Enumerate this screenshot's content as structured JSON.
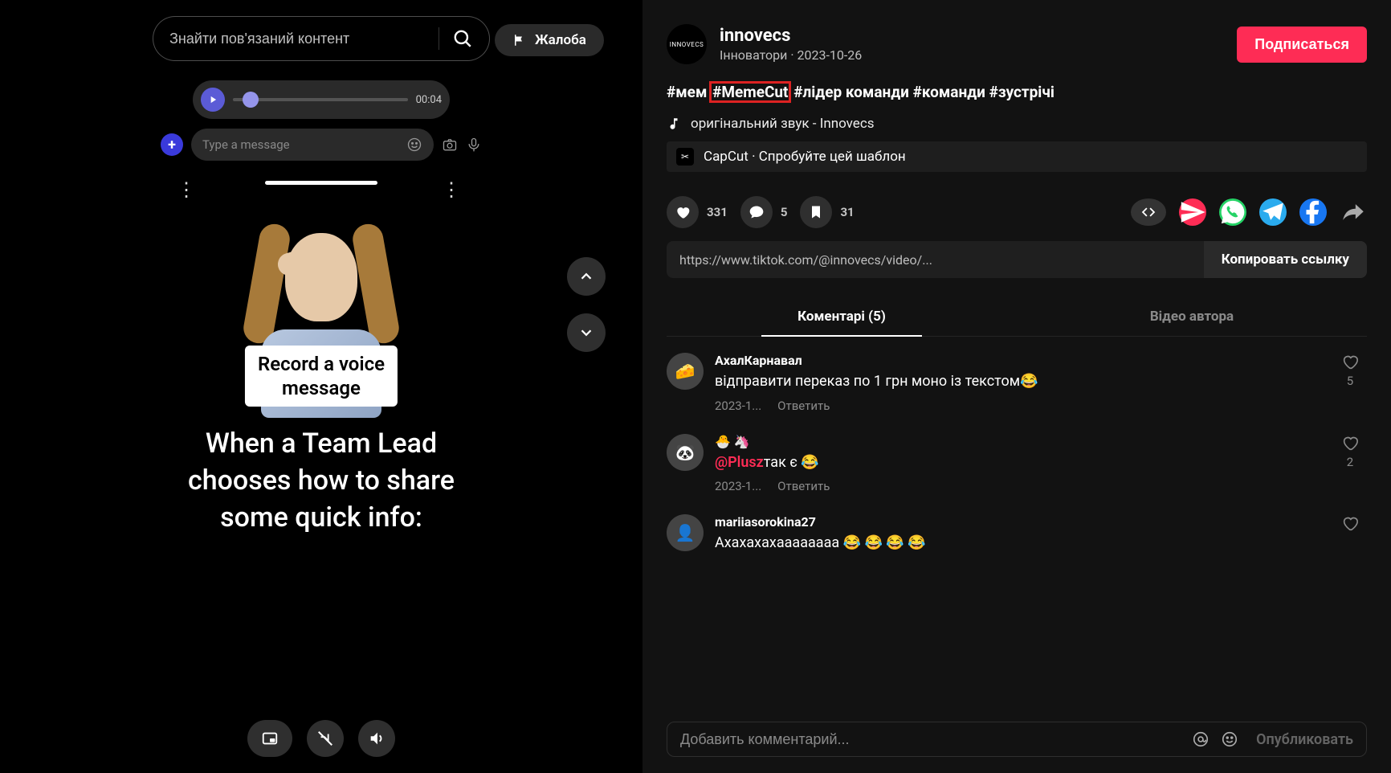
{
  "search": {
    "placeholder": "Знайти пов'язаний контент"
  },
  "report_label": "Жалоба",
  "audio": {
    "time": "00:04"
  },
  "message_placeholder": "Type a message",
  "caption_white": "Record a voice message",
  "caption_big": "When a Team Lead chooses how to share some quick info:",
  "user": {
    "name": "innovecs",
    "avatar_text": "INNOVECS",
    "sub": "Інноватори · 2023-10-26",
    "subscribe_label": "Подписаться"
  },
  "hashtags": [
    "#мем",
    "#MemeCut",
    "#лідер команди",
    "#команди",
    "#зустрічі"
  ],
  "highlighted_tag_index": 1,
  "music": "оригінальний звук - Innovecs",
  "capcut": "CapCut · Спробуйте цей шаблон",
  "engagement": {
    "likes": "331",
    "comments": "5",
    "saves": "31"
  },
  "url_text": "https://www.tiktok.com/@innovecs/video/...",
  "copy_label": "Копировать ссылку",
  "tabs": {
    "active": "Коментарі (5)",
    "inactive": "Відео автора"
  },
  "comments": [
    {
      "name": "АхалКарнавал",
      "avatar_emoji": "🧀",
      "text": "відправити переказ по 1 грн моно із текстом😂",
      "date": "2023-1...",
      "reply": "Ответить",
      "likes": "5"
    },
    {
      "name": "🐣 🦄",
      "avatar_emoji": "🐼",
      "mention": "@Plusz",
      "text_after": "так є 😂",
      "date": "2023-1...",
      "reply": "Ответить",
      "likes": "2"
    },
    {
      "name": "mariiasorokina27",
      "avatar_emoji": "👤",
      "text": "Ахахахахаааааааа 😂 😂 😂 😂",
      "date": "",
      "reply": "",
      "likes": ""
    }
  ],
  "comment_input": {
    "placeholder": "Добавить комментарий...",
    "publish": "Опубликовать"
  }
}
